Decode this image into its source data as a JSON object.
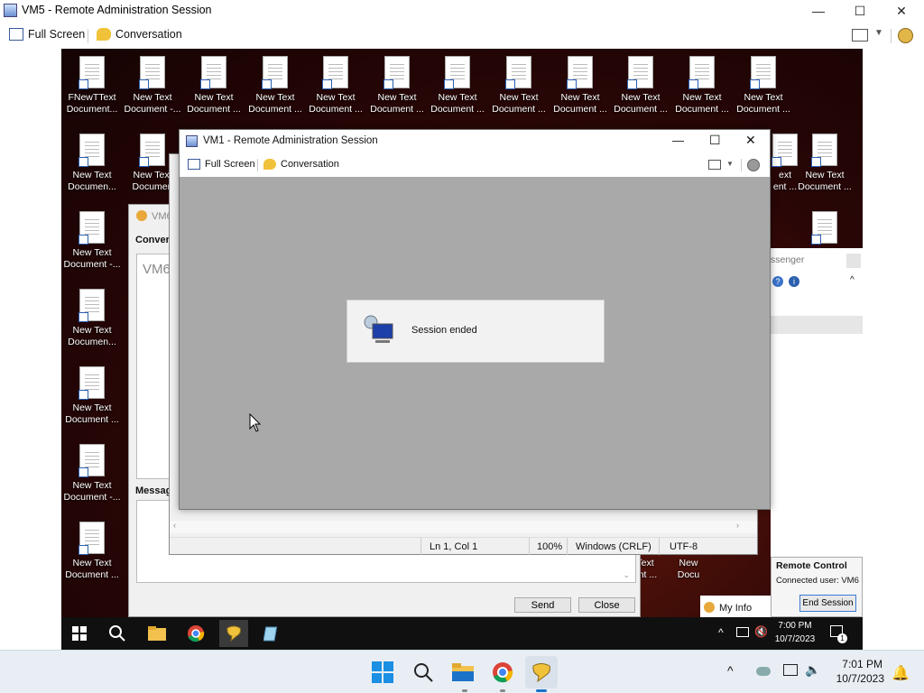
{
  "outer": {
    "title": "VM5 - Remote Administration Session",
    "toolbar": {
      "full_screen": "Full Screen",
      "conversation": "Conversation"
    },
    "controls": {
      "minimize": "—",
      "maximize": "☐",
      "close": "✕"
    }
  },
  "desktop": {
    "icons_top_row": [
      "FNewTText\nDocument...",
      "New Text\nDocument -...",
      "New Text\nDocument ...",
      "New Text\nDocument ...",
      "New Text\nDocument ...",
      "New Text\nDocument ...",
      "New Text\nDocument ...",
      "New Text\nDocument ...",
      "New Text\nDocument ...",
      "New Text\nDocument ...",
      "New Text\nDocument ...",
      "New Text\nDocument ..."
    ],
    "icons_left_col": [
      "New Text\nDocumen...",
      "New Text\nDocument -...",
      "New Text\nDocumen...",
      "New Text\nDocument ...",
      "New Text\nDocument -...",
      "New Text\nDocument ..."
    ],
    "icon_second_col": "New Text\nDocumen",
    "icon_right_row2": "New Text\nDocument ...",
    "icon_right_row2_partial": "ext\nent ...",
    "icons_bottom_partial": [
      "Text\nent ...",
      "New\nDocu"
    ]
  },
  "messenger": {
    "title_partial": "VM6",
    "conversation_label": "Convers",
    "conv_text": "VM6",
    "message_label": "Messag",
    "send": "Send",
    "close": "Close",
    "messenger_partial": "ssenger",
    "my_info": "My Info"
  },
  "notepad": {
    "status": {
      "position": "Ln 1, Col 1",
      "zoom": "100%",
      "eol": "Windows (CRLF)",
      "encoding": "UTF-8"
    }
  },
  "vm1": {
    "title": "VM1 - Remote Administration Session",
    "toolbar": {
      "full_screen": "Full Screen",
      "conversation": "Conversation"
    },
    "session_message": "Session ended"
  },
  "remote_control": {
    "title": "Remote Control",
    "connected": "Connected user: VM6",
    "end_session": "End Session"
  },
  "inner_taskbar": {
    "time": "7:00 PM",
    "date": "10/7/2023",
    "notif_count": "1"
  },
  "outer_taskbar": {
    "time": "7:01 PM",
    "date": "10/7/2023"
  }
}
